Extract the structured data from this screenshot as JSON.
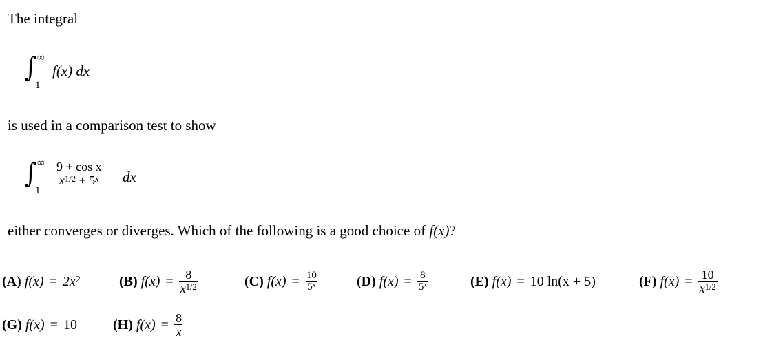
{
  "question": {
    "intro": "The integral",
    "comparison_integral": {
      "lower": "1",
      "upper": "∞",
      "integrand": "f(x) dx"
    },
    "middle": "is used in a comparison test to show",
    "target_integral": {
      "lower": "1",
      "upper": "∞",
      "numerator": "9 + cos x",
      "denominator_base": "x",
      "denominator_exp": "1/2",
      "denominator_rest": " + 5",
      "denominator_rest_exp": "x",
      "differential": "dx"
    },
    "prompt_prefix": "either converges or diverges. Which of the following is a good choice of ",
    "prompt_fx": "f(x)",
    "prompt_suffix": "?"
  },
  "choices": [
    {
      "label": "(A)",
      "lhs": "f(x)",
      "eq": "=",
      "rhs_text": "2x",
      "rhs_exp": "2"
    },
    {
      "label": "(B)",
      "lhs": "f(x)",
      "eq": "=",
      "num": "8",
      "den": "x",
      "den_exp": "1/2"
    },
    {
      "label": "(C)",
      "lhs": "f(x)",
      "eq": "=",
      "num": "10",
      "den": "5",
      "den_exp": "x"
    },
    {
      "label": "(D)",
      "lhs": "f(x)",
      "eq": "=",
      "num": "8",
      "den": "5",
      "den_exp": "x"
    },
    {
      "label": "(E)",
      "lhs": "f(x)",
      "eq": "=",
      "rhs_text": "10 ln(x + 5)"
    },
    {
      "label": "(F)",
      "lhs": "f(x)",
      "eq": "=",
      "num": "10",
      "den": "x",
      "den_exp": "1/2"
    },
    {
      "label": "(G)",
      "lhs": "f(x)",
      "eq": "=",
      "rhs_text": "10"
    },
    {
      "label": "(H)",
      "lhs": "f(x)",
      "eq": "=",
      "num": "8",
      "den": "x"
    }
  ]
}
